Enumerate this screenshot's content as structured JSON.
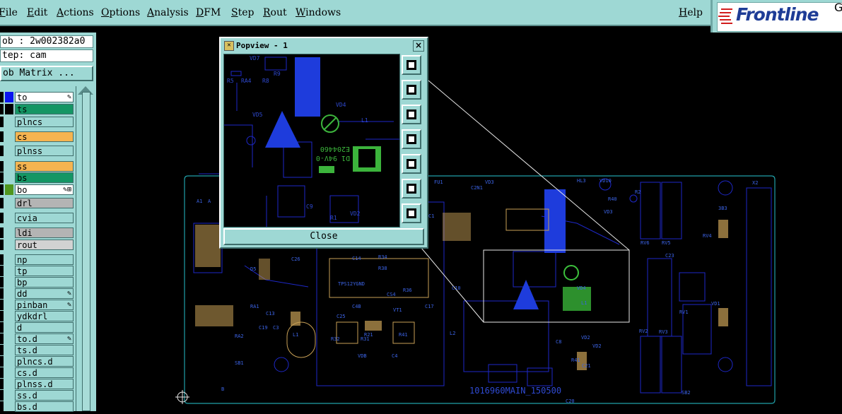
{
  "menu": {
    "items": [
      "File",
      "Edit",
      "Actions",
      "Options",
      "Analysis",
      "DFM",
      "Step",
      "Rout",
      "Windows"
    ],
    "help": "Help"
  },
  "logo": {
    "wordmark": "Frontline",
    "trailing": "G"
  },
  "job": {
    "job_label": "ob : 2w002382a0",
    "step_label": "tep: cam",
    "matrix_button": "ob Matrix ..."
  },
  "layers": [
    {
      "name": "to",
      "color": "#0a14f0",
      "bg": "#ffffff",
      "mark": "✎"
    },
    {
      "name": "ts",
      "color": "#000000",
      "bg": "#149664",
      "mark": ""
    },
    {
      "name": "plncs",
      "color": "",
      "bg": "#9ed8d4",
      "mark": ""
    },
    {
      "name": "cs",
      "color": "",
      "bg": "#f5b450",
      "mark": ""
    },
    {
      "name": "plnss",
      "color": "",
      "bg": "#9ed8d4",
      "mark": ""
    },
    {
      "name": "ss",
      "color": "",
      "bg": "#f5b450",
      "mark": ""
    },
    {
      "name": "bs",
      "color": "",
      "bg": "#149664",
      "mark": ""
    },
    {
      "name": "bo",
      "color": "#50961e",
      "bg": "#ffffff",
      "mark": "✎⊞"
    },
    {
      "name": "drl",
      "color": "",
      "bg": "#b4b4b4",
      "mark": ""
    },
    {
      "name": "cvia",
      "color": "",
      "bg": "#9ed8d4",
      "mark": ""
    },
    {
      "name": "ldi",
      "color": "",
      "bg": "#b4b4b4",
      "mark": ""
    },
    {
      "name": "rout",
      "color": "",
      "bg": "#d2d2d2",
      "mark": ""
    },
    {
      "name": "np",
      "color": "",
      "bg": "#9ed8d4",
      "mark": ""
    },
    {
      "name": "tp",
      "color": "",
      "bg": "#9ed8d4",
      "mark": ""
    },
    {
      "name": "bp",
      "color": "",
      "bg": "#9ed8d4",
      "mark": ""
    },
    {
      "name": "dd",
      "color": "",
      "bg": "#9ed8d4",
      "mark": "✎"
    },
    {
      "name": "pinban",
      "color": "",
      "bg": "#9ed8d4",
      "mark": "✎"
    },
    {
      "name": "ydkdrl",
      "color": "",
      "bg": "#9ed8d4",
      "mark": ""
    },
    {
      "name": "d",
      "color": "",
      "bg": "#9ed8d4",
      "mark": ""
    },
    {
      "name": "to.d",
      "color": "",
      "bg": "#9ed8d4",
      "mark": "✎"
    },
    {
      "name": "ts.d",
      "color": "",
      "bg": "#9ed8d4",
      "mark": ""
    },
    {
      "name": "plncs.d",
      "color": "",
      "bg": "#9ed8d4",
      "mark": ""
    },
    {
      "name": "cs.d",
      "color": "",
      "bg": "#9ed8d4",
      "mark": ""
    },
    {
      "name": "plnss.d",
      "color": "",
      "bg": "#9ed8d4",
      "mark": ""
    },
    {
      "name": "ss.d",
      "color": "",
      "bg": "#9ed8d4",
      "mark": ""
    },
    {
      "name": "bs.d",
      "color": "",
      "bg": "#9ed8d4",
      "mark": ""
    }
  ],
  "board": {
    "label": "1016960MAIN_150500",
    "refs": [
      "X2",
      "HL3",
      "VD10",
      "R40",
      "R2",
      "VD3",
      "RV6",
      "RV5",
      "RV4",
      "3B3",
      "C23",
      "VD1",
      "RV1",
      "RV2",
      "RV3",
      "SB2",
      "VD2",
      "R41",
      "C21",
      "C20",
      "C8",
      "L2",
      "C10",
      "L1",
      "VD4",
      "VD3",
      "C2N1",
      "C1",
      "C4",
      "FU1",
      "A1",
      "A",
      "B",
      "SB1",
      "TPS12YGND",
      "C25",
      "C4B",
      "D5",
      "C26",
      "VT1",
      "CS4",
      "R36",
      "R38",
      "R34",
      "R31",
      "R32",
      "C17",
      "C14",
      "R21",
      "R41",
      "VDB",
      "C4",
      "RA1",
      "RA2",
      "C13",
      "C19",
      "C3",
      "L1",
      "VD2"
    ]
  },
  "popview": {
    "title": "Popview - 1",
    "close_label": "Close",
    "refs": [
      "VD7",
      "R9",
      "R8",
      "RA4",
      "R5",
      "VD4",
      "VD5",
      "L1",
      "C9",
      "VD2",
      "R1",
      "E204460",
      "D1 94V-0"
    ]
  }
}
